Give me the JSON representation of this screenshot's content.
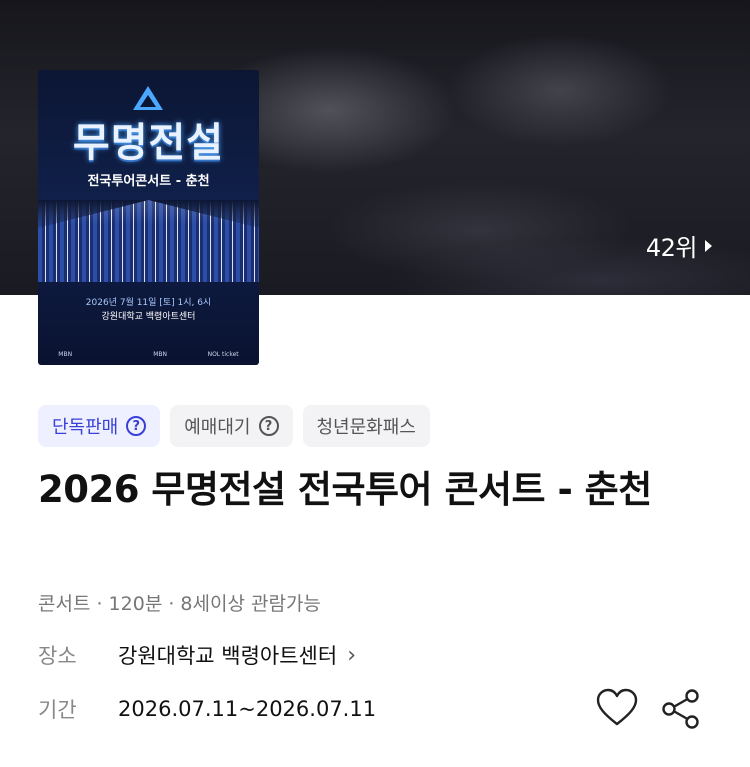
{
  "hero": {
    "rank_label": "42위"
  },
  "poster": {
    "title": "무명전설",
    "subtitle": "전국투어콘서트 - 춘천",
    "date": "2026년 7월 11일 [토] 1시, 6시",
    "venue": "강원대학교 백령아트센터",
    "sponsors": [
      "MBN",
      "",
      "MBN",
      "NOL ticket"
    ]
  },
  "badges": [
    {
      "label": "단독판매",
      "has_help": true
    },
    {
      "label": "예매대기",
      "has_help": true
    },
    {
      "label": "청년문화패스",
      "has_help": false
    }
  ],
  "event": {
    "title": "2026 무명전설 전국투어 콘서트 - 춘천",
    "meta": "콘서트 · 120분 · 8세이상 관람가능",
    "venue_label": "장소",
    "venue_value": "강원대학교 백령아트센터",
    "period_label": "기간",
    "period_value": "2026.07.11~2026.07.11"
  },
  "icons": {
    "help": "question-circle-icon",
    "chevron": "chevron-right-icon",
    "like": "heart-icon",
    "share": "share-icon"
  },
  "colors": {
    "accent": "#3a3fd8",
    "accent_bg": "#eef0ff",
    "badge_bg": "#f3f3f5"
  }
}
